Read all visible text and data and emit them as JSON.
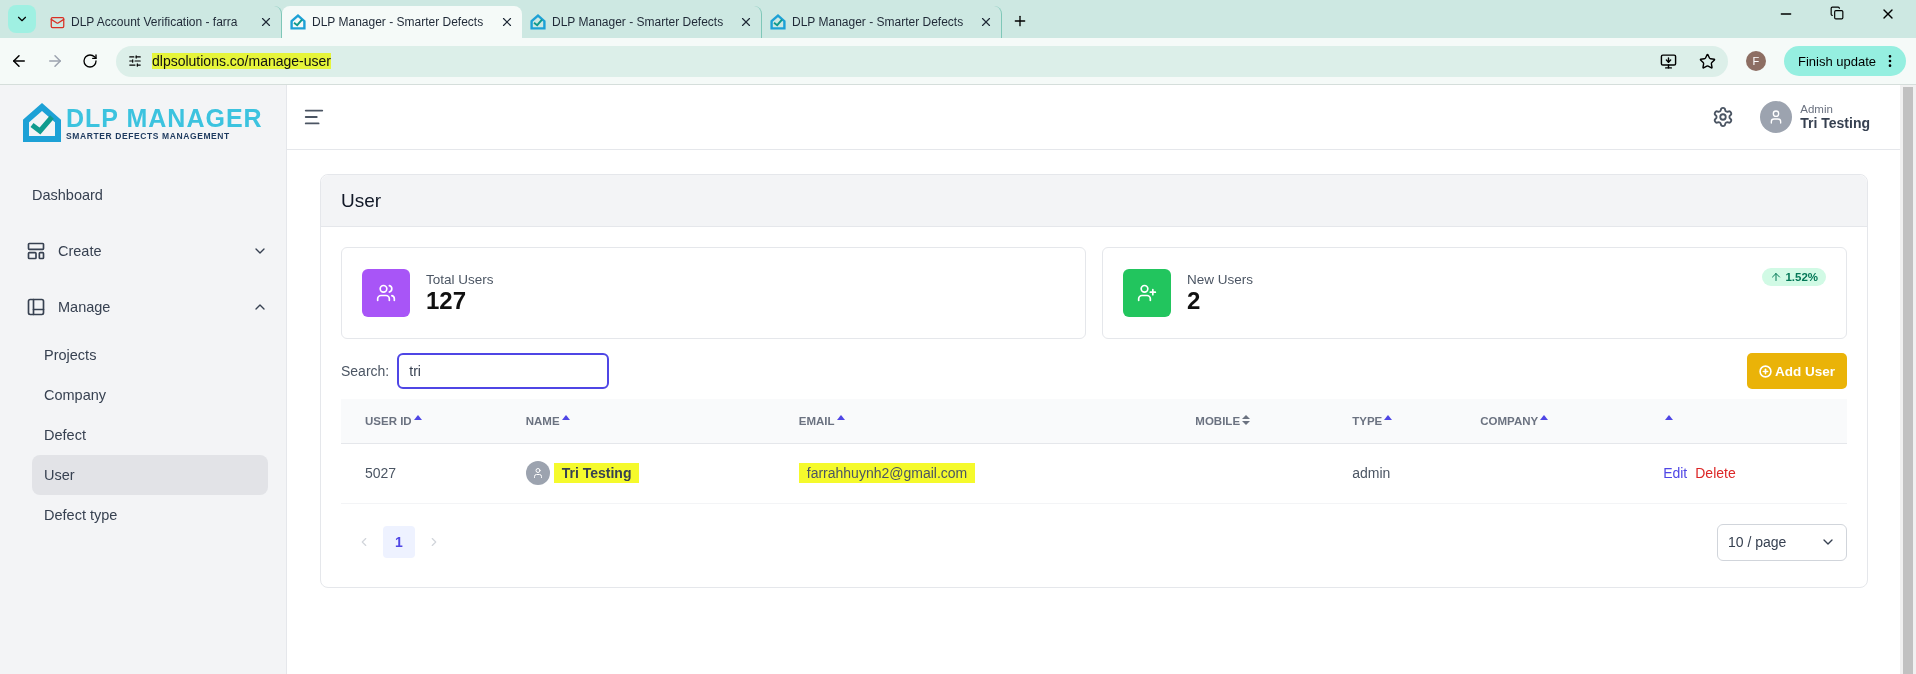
{
  "browser": {
    "tabs": [
      {
        "title": "DLP Account Verification - farra",
        "selected": false
      },
      {
        "title": "DLP Manager - Smarter Defects",
        "selected": true
      },
      {
        "title": "DLP Manager - Smarter Defects",
        "selected": false
      },
      {
        "title": "DLP Manager - Smarter Defects",
        "selected": false
      }
    ],
    "url": "dlpsolutions.co/manage-user",
    "url_highlighted": true,
    "profile_initial": "F",
    "update_button": "Finish update"
  },
  "sidebar": {
    "logo_title": "DLP MANAGER",
    "logo_subtitle": "SMARTER DEFECTS MANAGEMENT",
    "items": [
      {
        "label": "Dashboard",
        "kind": "link",
        "selected": false
      },
      {
        "label": "Create",
        "kind": "group",
        "expanded": false
      },
      {
        "label": "Manage",
        "kind": "group",
        "expanded": true,
        "children": [
          {
            "label": "Projects",
            "selected": false
          },
          {
            "label": "Company",
            "selected": false
          },
          {
            "label": "Defect",
            "selected": false
          },
          {
            "label": "User",
            "selected": true
          },
          {
            "label": "Defect type",
            "selected": false
          }
        ]
      }
    ]
  },
  "header": {
    "role": "Admin",
    "user_name": "Tri Testing"
  },
  "page": {
    "title": "User",
    "stats": [
      {
        "label": "Total Users",
        "value": "127",
        "color": "#a855f7"
      },
      {
        "label": "New Users",
        "value": "2",
        "color": "#22c55e",
        "trend": "1.52%"
      }
    ],
    "search": {
      "label": "Search:",
      "value": "tri"
    },
    "add_button": "Add User",
    "table": {
      "columns": [
        {
          "label": "USER ID"
        },
        {
          "label": "NAME"
        },
        {
          "label": "EMAIL"
        },
        {
          "label": "MOBILE"
        },
        {
          "label": "TYPE"
        },
        {
          "label": "COMPANY"
        },
        {}
      ],
      "rows": [
        {
          "user_id": "5027",
          "name": "Tri Testing",
          "name_highlighted": true,
          "email": "farrahhuynh2@gmail.com",
          "email_highlighted": true,
          "type": "admin",
          "actions": [
            "Edit",
            "Delete"
          ]
        }
      ]
    },
    "pagination": {
      "pages": [
        {
          "label": "1",
          "selected": true
        }
      ],
      "page_size": "10 / page"
    }
  }
}
